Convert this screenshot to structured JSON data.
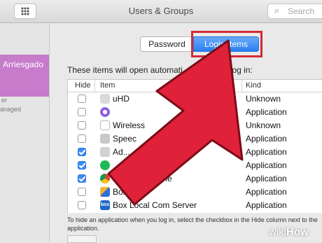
{
  "window": {
    "title": "Users & Groups"
  },
  "search": {
    "placeholder": "Search"
  },
  "sidebar": {
    "user_name": "Arriesgado",
    "line1": "er",
    "line2": "anaged"
  },
  "tabs": {
    "password": "Password",
    "login_items": "Login Items"
  },
  "description": "These items will open automati... when you log in:",
  "table": {
    "headers": {
      "hide": "Hide",
      "item": "Item",
      "kind": "Kind"
    },
    "rows": [
      {
        "checked": false,
        "name": "uHD",
        "kind": "Unknown",
        "icon": "generic-app-icon"
      },
      {
        "checked": false,
        "name": "",
        "kind": "Application",
        "icon": "itunes-icon"
      },
      {
        "checked": false,
        "name": "Wireless",
        "kind": "Unknown",
        "icon": "blank-document-icon"
      },
      {
        "checked": false,
        "name": "Speec",
        "kind": "Application",
        "icon": "speech-app-icon"
      },
      {
        "checked": true,
        "name": "Ad... ...rce... ...onizer",
        "kind": "Application",
        "icon": "generic-app-icon"
      },
      {
        "checked": true,
        "name": "",
        "kind": "Application",
        "icon": "spotify-icon"
      },
      {
        "checked": true,
        "name": "Google Chrome",
        "kind": "Application",
        "icon": "chrome-icon"
      },
      {
        "checked": false,
        "name": "Box Edit",
        "kind": "Application",
        "icon": "box-edit-icon"
      },
      {
        "checked": false,
        "name": "Box Local Com Server",
        "kind": "Application",
        "icon": "box-icon"
      }
    ]
  },
  "footer": "To hide an application when you log in, select the checkbox in the Hide column next to the application.",
  "watermark": {
    "wiki": "wiki",
    "how": "How"
  },
  "colors": {
    "accent_blue": "#2a7ff3",
    "highlight_red": "#d42b36",
    "arrow_red": "#e0213a",
    "user_purple": "#c67bcb"
  }
}
